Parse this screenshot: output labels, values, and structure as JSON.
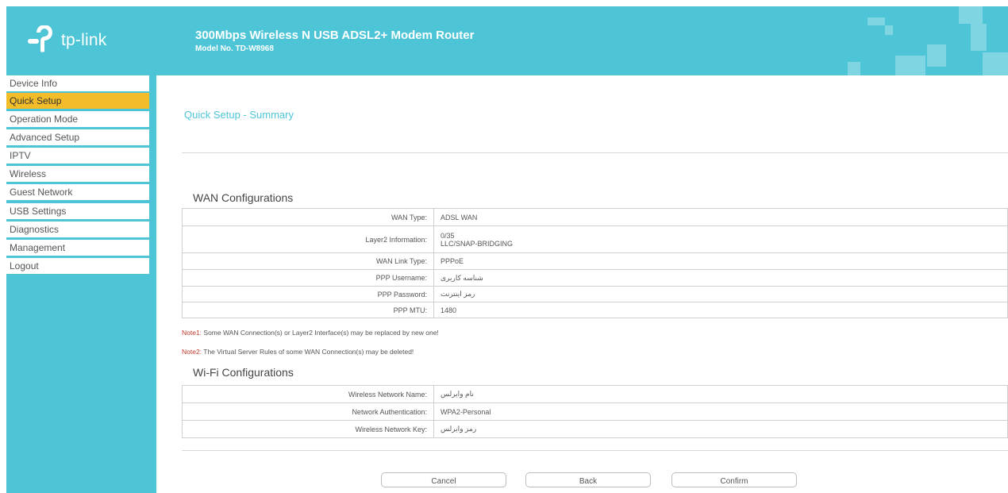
{
  "header": {
    "logo_text": "tp-link",
    "product_title": "300Mbps Wireless N USB ADSL2+ Modem Router",
    "model_no": "Model No. TD-W8968"
  },
  "sidebar": {
    "items": [
      {
        "label": "Device Info"
      },
      {
        "label": "Quick Setup",
        "active": true
      },
      {
        "label": "Operation Mode"
      },
      {
        "label": "Advanced Setup"
      },
      {
        "label": "IPTV"
      },
      {
        "label": "Wireless"
      },
      {
        "label": "Guest Network"
      },
      {
        "label": "USB Settings"
      },
      {
        "label": "Diagnostics"
      },
      {
        "label": "Management"
      },
      {
        "label": "Logout"
      }
    ]
  },
  "main": {
    "page_title": "Quick Setup - Summary",
    "wan": {
      "title": "WAN Configurations",
      "rows": [
        {
          "label": "WAN Type:",
          "value": "ADSL WAN"
        },
        {
          "label": "Layer2 Information:",
          "value_line1": "0/35",
          "value_line2": "LLC/SNAP-BRIDGING"
        },
        {
          "label": "WAN Link Type:",
          "value": "PPPoE"
        },
        {
          "label": "PPP Username:",
          "value": "شناسه کاربری"
        },
        {
          "label": "PPP Password:",
          "value": "رمز اینترنت"
        },
        {
          "label": "PPP MTU:",
          "value": "1480"
        }
      ]
    },
    "notes": [
      {
        "tag": "Note1:",
        "text": " Some WAN Connection(s) or Layer2 Interface(s) may be replaced by new one!"
      },
      {
        "tag": "Note2:",
        "text": " The Virtual Server Rules of some WAN Connection(s) may be deleted!"
      }
    ],
    "wifi": {
      "title": "Wi-Fi Configurations",
      "rows": [
        {
          "label": "Wireless Network Name:",
          "value": "نام وایرلس"
        },
        {
          "label": "Network Authentication:",
          "value": "WPA2-Personal"
        },
        {
          "label": "Wireless Network Key:",
          "value": "رمز وایرلس"
        }
      ]
    },
    "buttons": {
      "cancel": "Cancel",
      "back": "Back",
      "confirm": "Confirm"
    }
  },
  "colors": {
    "accent": "#4ec5d6",
    "active_menu": "#f2bd28",
    "note_tag": "#c0392b"
  }
}
